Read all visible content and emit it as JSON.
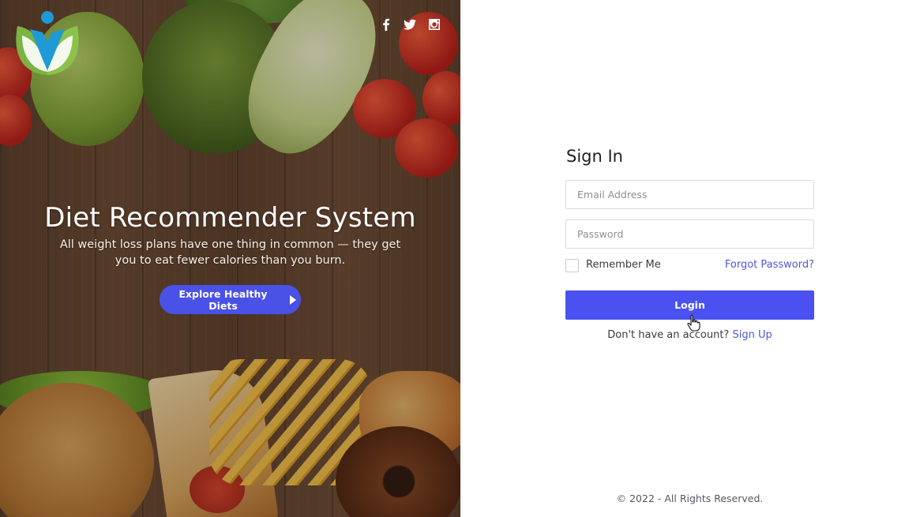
{
  "brand": {
    "logo_icon": "person-leaf-logo-icon",
    "colors": {
      "leaf": "#7cb342",
      "leaf_dark": "#558b2f",
      "person": "#1e9ad6"
    }
  },
  "social": [
    {
      "name": "facebook",
      "icon": "facebook-icon"
    },
    {
      "name": "twitter",
      "icon": "twitter-icon"
    },
    {
      "name": "instagram",
      "icon": "instagram-icon"
    }
  ],
  "hero": {
    "title": "Diet Recommender System",
    "subtitle": "All weight loss plans have one thing in common — they get you to eat fewer calories than you burn.",
    "cta_label": "Explore Healthy Diets",
    "cta_icon": "play-icon",
    "cta_color": "#4a51e6"
  },
  "signin": {
    "title": "Sign In",
    "email_placeholder": "Email Address",
    "password_placeholder": "Password",
    "remember_label": "Remember Me",
    "remember_checked": false,
    "forgot_label": "Forgot Password?",
    "login_label": "Login",
    "login_color": "#4a51f0",
    "no_account_text": "Don't have an account?",
    "signup_label": "Sign Up"
  },
  "footer": {
    "text": "© 2022 - All Rights Reserved."
  }
}
